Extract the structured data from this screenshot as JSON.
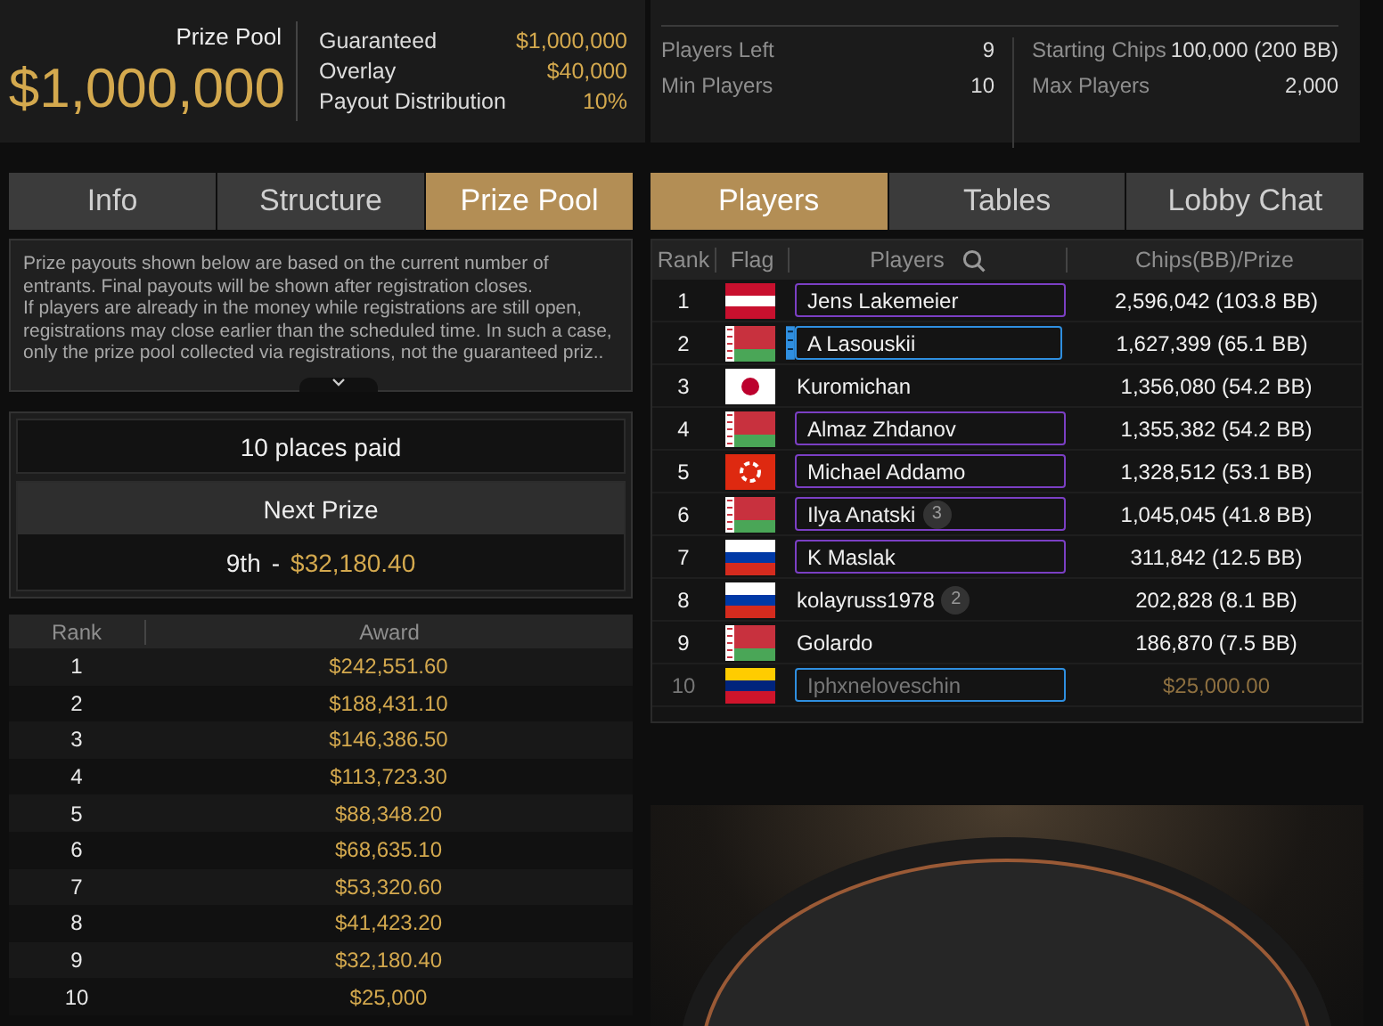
{
  "prize_summary": {
    "label": "Prize Pool",
    "amount": "$1,000,000",
    "details": [
      {
        "label": "Guaranteed",
        "value": "$1,000,000"
      },
      {
        "label": "Overlay",
        "value": "$40,000"
      },
      {
        "label": "Payout Distribution",
        "value": "10%"
      }
    ]
  },
  "tournament_stats": {
    "left": [
      {
        "label": "Players Left",
        "value": "9"
      },
      {
        "label": "Min Players",
        "value": "10"
      }
    ],
    "right": [
      {
        "label": "Starting Chips",
        "value": "100,000 (200 BB)"
      },
      {
        "label": "Max Players",
        "value": "2,000"
      }
    ]
  },
  "left_tabs": [
    {
      "label": "Info",
      "selected": false
    },
    {
      "label": "Structure",
      "selected": false
    },
    {
      "label": "Prize Pool",
      "selected": true
    }
  ],
  "info_text": [
    "Prize payouts shown below are based on the current number of entrants. Final payouts will be shown after registration closes.",
    "If players are already in the money while registrations are still open, registrations may close earlier than the scheduled time. In such a case, only the prize pool collected via registrations, not the guaranteed priz.."
  ],
  "places_paid": "10 places paid",
  "next_prize": {
    "title": "Next Prize",
    "place": "9th",
    "separator": "-",
    "amount": "$32,180.40"
  },
  "awards": {
    "columns": [
      "Rank",
      "Award"
    ],
    "rows": [
      {
        "rank": "1",
        "award": "$242,551.60"
      },
      {
        "rank": "2",
        "award": "$188,431.10"
      },
      {
        "rank": "3",
        "award": "$146,386.50"
      },
      {
        "rank": "4",
        "award": "$113,723.30"
      },
      {
        "rank": "5",
        "award": "$88,348.20"
      },
      {
        "rank": "6",
        "award": "$68,635.10"
      },
      {
        "rank": "7",
        "award": "$53,320.60"
      },
      {
        "rank": "8",
        "award": "$41,423.20"
      },
      {
        "rank": "9",
        "award": "$32,180.40"
      },
      {
        "rank": "10",
        "award": "$25,000"
      }
    ]
  },
  "right_tabs": [
    {
      "label": "Players",
      "selected": true
    },
    {
      "label": "Tables",
      "selected": false
    },
    {
      "label": "Lobby Chat",
      "selected": false
    }
  ],
  "players": {
    "columns": [
      "Rank",
      "Flag",
      "Players",
      "Chips(BB)/Prize"
    ],
    "rows": [
      {
        "rank": "1",
        "kind": "austria",
        "name": "Jens Lakemeier",
        "color": "#7b3fc4",
        "chips": "2,596,042 (103.8 BB)",
        "finished": false
      },
      {
        "rank": "2",
        "kind": "belarus",
        "name": "A Lasouskii",
        "color": "#2f8fe0",
        "marker": true,
        "chips": "1,627,399 (65.1 BB)",
        "finished": false
      },
      {
        "rank": "3",
        "kind": "japan",
        "name": "Kuromichan",
        "chips": "1,356,080 (54.2 BB)",
        "finished": false
      },
      {
        "rank": "4",
        "kind": "belarus",
        "name": "Almaz Zhdanov",
        "color": "#7b3fc4",
        "chips": "1,355,382 (54.2 BB)",
        "finished": false
      },
      {
        "rank": "5",
        "kind": "hong-kong",
        "name": "Michael Addamo",
        "color": "#7b3fc4",
        "chips": "1,328,512 (53.1 BB)",
        "finished": false
      },
      {
        "rank": "6",
        "kind": "belarus",
        "name": "Ilya Anatski",
        "color": "#7b3fc4",
        "badge": "3",
        "chips": "1,045,045 (41.8 BB)",
        "finished": false
      },
      {
        "rank": "7",
        "kind": "russia",
        "name": "K Maslak",
        "color": "#7b3fc4",
        "chips": "311,842 (12.5 BB)",
        "finished": false
      },
      {
        "rank": "8",
        "kind": "russia",
        "name": "kolayruss1978",
        "badge": "2",
        "chips": "202,828 (8.1 BB)",
        "finished": false
      },
      {
        "rank": "9",
        "kind": "belarus",
        "name": "Golardo",
        "chips": "186,870 (7.5 BB)",
        "finished": false
      },
      {
        "rank": "10",
        "kind": "venezuela",
        "name": "Iphxneloveschin",
        "color": "#2f8fe0",
        "chips": "$25,000.00",
        "finished": true
      }
    ]
  }
}
